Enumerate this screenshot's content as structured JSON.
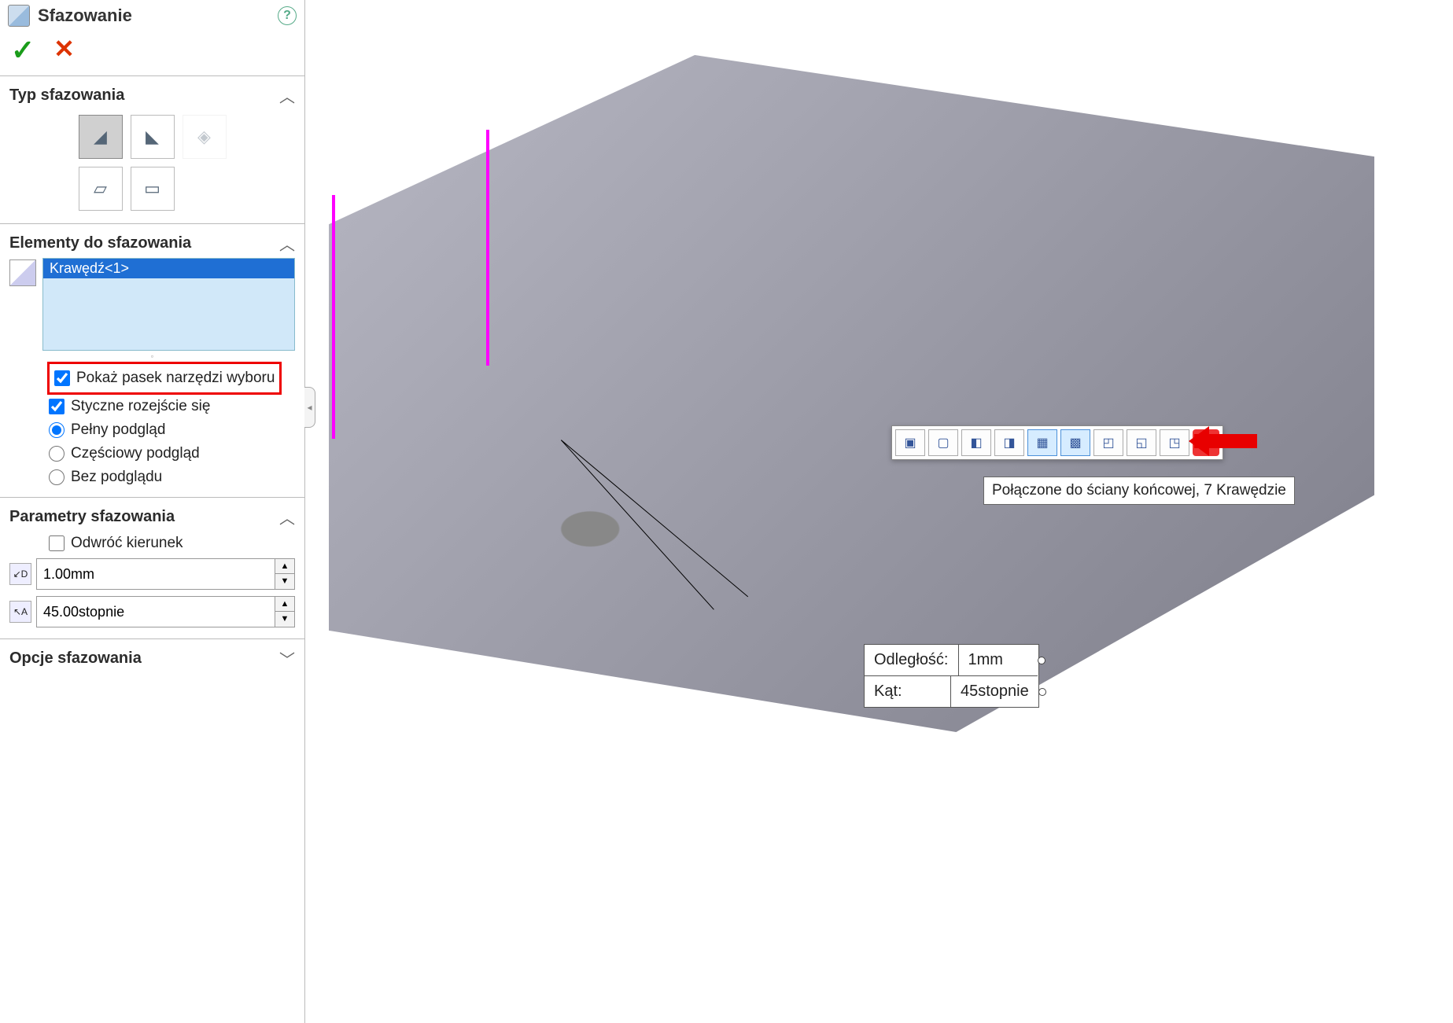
{
  "panel": {
    "title": "Sfazowanie",
    "confirm_icon": "✓",
    "cancel_icon": "✕",
    "help_icon": "?"
  },
  "sections": {
    "type": {
      "title": "Typ sfazowania"
    },
    "elements": {
      "title": "Elementy do sfazowania",
      "selected_item": "Krawędź<1>",
      "show_toolbar": "Pokaż pasek narzędzi wyboru",
      "tangent": "Styczne rozejście się",
      "preview_full": "Pełny podgląd",
      "preview_partial": "Częściowy podgląd",
      "preview_none": "Bez podglądu"
    },
    "params": {
      "title": "Parametry sfazowania",
      "reverse": "Odwróć kierunek",
      "distance": "1.00mm",
      "angle": "45.00stopnie"
    },
    "options": {
      "title": "Opcje sfazowania"
    }
  },
  "viewport": {
    "tooltip": "Połączone do ściany końcowej, 7 Krawędzie",
    "callout": {
      "distance_label": "Odległość:",
      "distance_value": "1mm",
      "angle_label": "Kąt:",
      "angle_value": "45stopnie"
    }
  },
  "type_icons": [
    "angle-distance",
    "distance-distance",
    "vertex",
    "face-face",
    "offset-face"
  ],
  "context_icons": [
    "inner-loop",
    "outer-loop",
    "left-face",
    "right-face",
    "connected-end",
    "feature",
    "body",
    "translate",
    "tangency"
  ]
}
